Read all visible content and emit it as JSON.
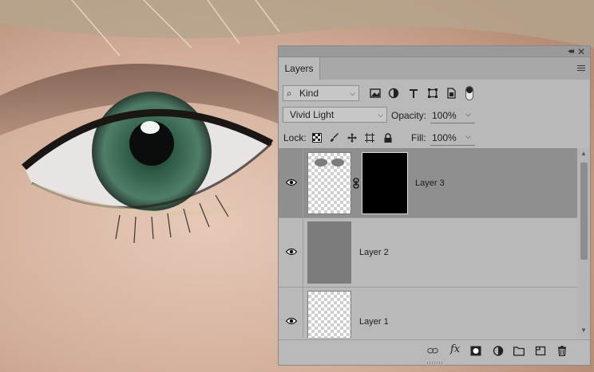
{
  "panel": {
    "title": "Layers",
    "menu_icon": "panel-menu-icon",
    "collapse_icon": "collapse-icon",
    "close_icon": "close-icon"
  },
  "filter": {
    "kind_label": "Kind",
    "icons": [
      "pixel-filter-icon",
      "adjustment-filter-icon",
      "type-filter-icon",
      "shape-filter-icon",
      "smart-object-filter-icon",
      "filter-toggle-icon"
    ]
  },
  "blend": {
    "mode": "Vivid Light",
    "opacity_label": "Opacity:",
    "opacity_value": "100%"
  },
  "lock": {
    "label": "Lock:",
    "icons": [
      "lock-transparent-icon",
      "lock-image-icon",
      "lock-position-icon",
      "lock-artboard-icon",
      "lock-all-icon"
    ],
    "fill_label": "Fill:",
    "fill_value": "100%"
  },
  "layers": [
    {
      "name": "Layer 3",
      "selected": true,
      "visible": true,
      "thumb": "transparent-with-gray-shapes",
      "has_mask": true
    },
    {
      "name": "Layer 2",
      "selected": false,
      "visible": true,
      "thumb": "gray-fill",
      "has_mask": false
    },
    {
      "name": "Layer 1",
      "selected": false,
      "visible": true,
      "thumb": "transparent",
      "has_mask": false
    }
  ],
  "bottom_toolbar": {
    "icons": [
      "link-layers-icon",
      "fx-icon",
      "add-mask-icon",
      "adjustment-layer-icon",
      "group-folder-icon",
      "new-layer-icon",
      "delete-icon"
    ],
    "fx_label": "fx"
  },
  "colors": {
    "panel_bg": "#b9b9b9",
    "selected_row": "#8f8f8f",
    "tab_bar": "#a8a8a8"
  }
}
